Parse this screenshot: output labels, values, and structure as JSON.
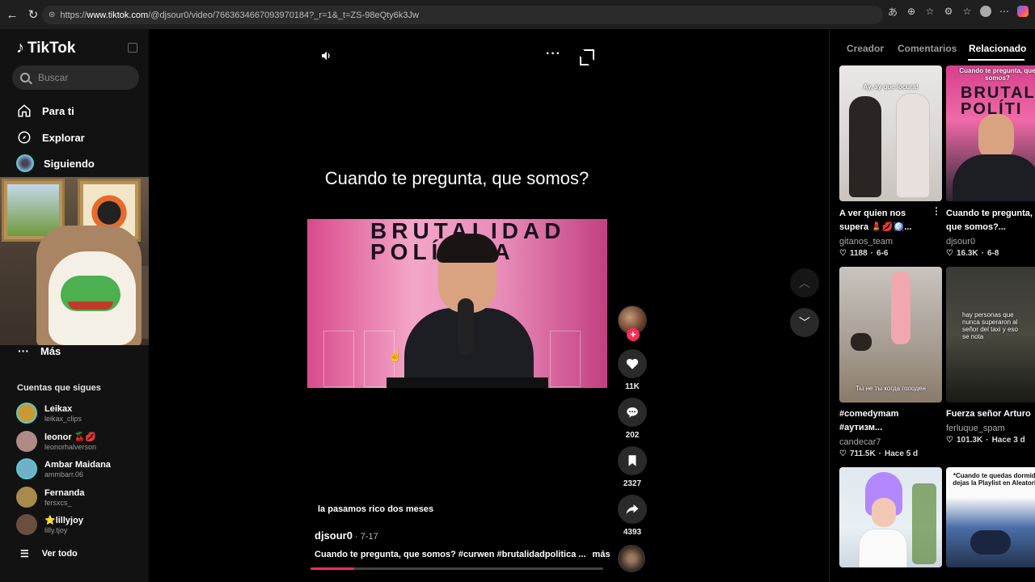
{
  "browser": {
    "url_prefix": "https://",
    "url_host": "www.tiktok.com",
    "url_path": "/@djsour0/video/7663634667093970184?_r=1&_t=ZS-98eQty6k3Jw"
  },
  "sidebar": {
    "brand": "TikTok",
    "search_placeholder": "Buscar",
    "nav": [
      {
        "label": "Para ti"
      },
      {
        "label": "Explorar"
      },
      {
        "label": "Siguiendo"
      }
    ],
    "more_label": "Más",
    "following_section": "Cuentas que sigues",
    "accounts": [
      {
        "name": "Leikax",
        "handle": "leikax_clips",
        "color": "#c99a34"
      },
      {
        "name": "leonor 🍒💋",
        "handle": "leonorhalverson",
        "color": "#b08a86"
      },
      {
        "name": "Ambar Maidana",
        "handle": "ammbarr.06",
        "color": "#6fb0c8"
      },
      {
        "name": "Fernanda",
        "handle": "fersxcs_",
        "color": "#a88a4c"
      },
      {
        "name": "⭐lillyjoy",
        "handle": "lilly.tjoy",
        "color": "#6a4e3e"
      }
    ],
    "see_all": "Ver todo"
  },
  "video": {
    "title": "Cuando te pregunta, que somos?",
    "banner": "BRUTALIDAD\nPOLÍTICA",
    "caption_small": "la pasamos rico dos meses",
    "author": "djsour0",
    "date": " · 7-17",
    "description": "Cuando te pregunta, que somos? #curwen #brutalidadpolitica ...",
    "more": "más",
    "progress": 0.15,
    "likes": "11K",
    "comments": "202",
    "saves": "2327",
    "shares": "4393",
    "accent": "#fe2c55"
  },
  "right_panel": {
    "tabs": [
      "Creador",
      "Comentarios",
      "Relacionado"
    ],
    "active_tab": "Relacionado",
    "cards": [
      {
        "title": "A ver quien nos supera 💄💋🪩...",
        "user": "gitanos_team",
        "likes": "1188",
        "age": "6-6",
        "overlay": "Ay, ay que locura!"
      },
      {
        "title": "Cuando te pregunta, que somos?...",
        "user": "djsour0",
        "likes": "16.3K",
        "age": "6-8",
        "overlay": "Cuando te pregunta, que somos?"
      },
      {
        "title": "#comedymam #аутизм...",
        "user": "candecar7",
        "likes": "711.5K",
        "age": "Hace 5 d",
        "overlay": "Ты не ты когда голоден"
      },
      {
        "title": "Fuerza señor Arturo",
        "user": "ferluque_spam",
        "likes": "101.3K",
        "age": "Hace 3 d",
        "overlay": "hay personas que nunca superaron al señor del taxi y eso se nota"
      },
      {
        "title": "",
        "user": "",
        "likes": "",
        "age": "",
        "overlay": ""
      },
      {
        "title": "",
        "user": "",
        "likes": "",
        "age": "",
        "overlay": "*Cuando te quedas dormid Y dejas la Playlist en Aleatorio:"
      }
    ]
  }
}
